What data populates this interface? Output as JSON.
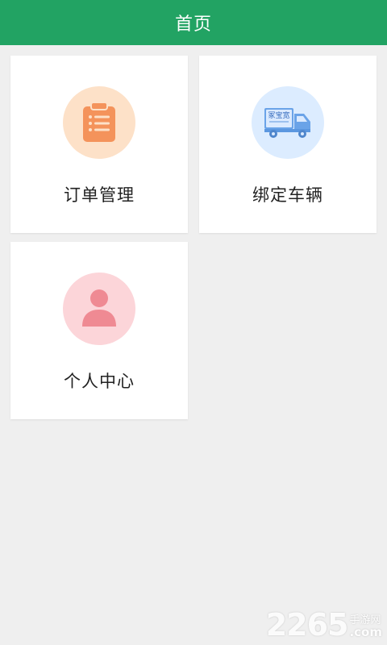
{
  "header": {
    "title": "首页"
  },
  "cards": [
    {
      "label": "订单管理",
      "icon": "clipboard-icon",
      "icon_bg": "#fde1c8",
      "icon_color": "#f4935b"
    },
    {
      "label": "绑定车辆",
      "icon": "truck-icon",
      "icon_bg": "#dcecff",
      "icon_color": "#5b97e0",
      "truck_text": "冢宝宽"
    },
    {
      "label": "个人中心",
      "icon": "person-icon",
      "icon_bg": "#fcd5d9",
      "icon_color": "#f08c95"
    }
  ],
  "colors": {
    "header_bg": "#22a363",
    "page_bg": "#efefef",
    "card_bg": "#ffffff"
  },
  "watermark": {
    "digits": "2265",
    "cn": "手游网",
    "com": ".com"
  }
}
